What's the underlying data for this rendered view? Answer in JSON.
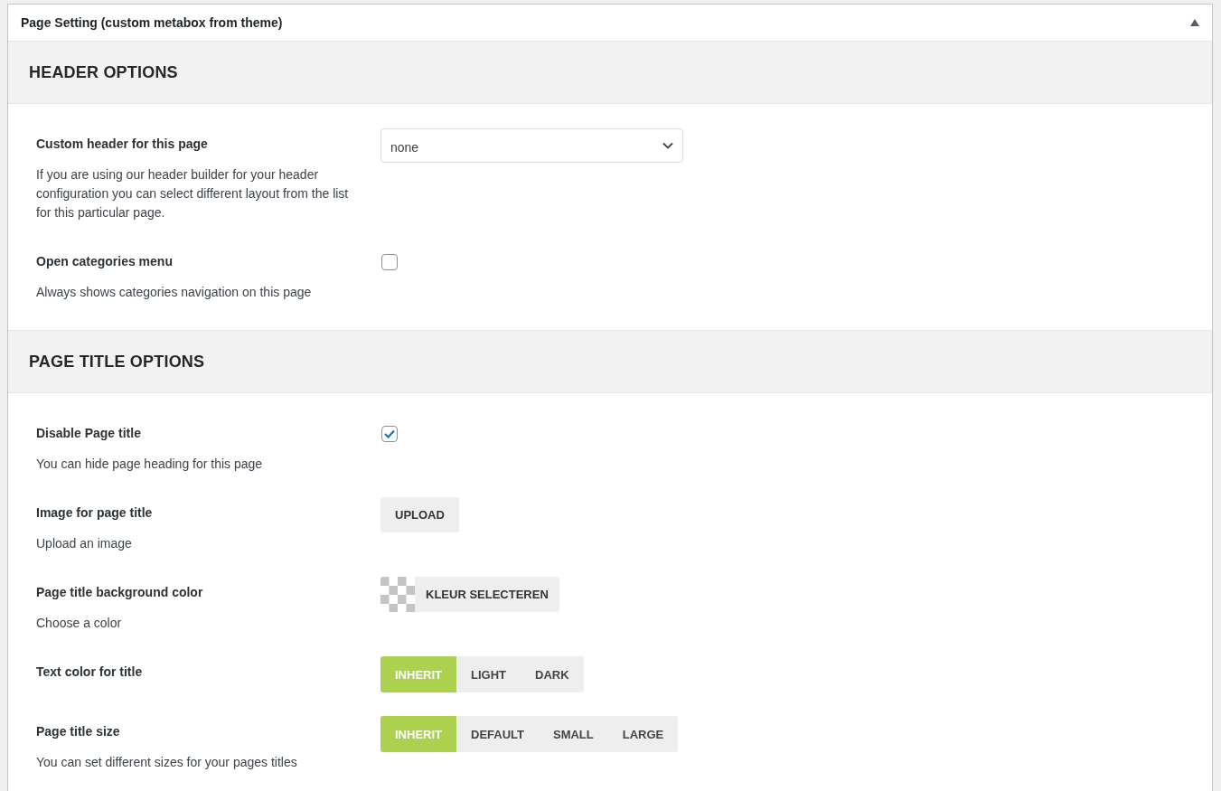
{
  "panel": {
    "title": "Page Setting (custom metabox from theme)",
    "expanded": true
  },
  "sections": [
    {
      "heading": "HEADER OPTIONS",
      "fields": [
        {
          "kind": "select",
          "label": "Custom header for this page",
          "description": "If you are using our header builder for your header configuration you can select different layout from the list for this particular page.",
          "value": "none"
        },
        {
          "kind": "checkbox",
          "label": "Open categories menu",
          "description": "Always shows categories navigation on this page",
          "checked": false
        }
      ]
    },
    {
      "heading": "PAGE TITLE OPTIONS",
      "fields": [
        {
          "kind": "checkbox",
          "label": "Disable Page title",
          "description": "You can hide page heading for this page",
          "checked": true
        },
        {
          "kind": "upload",
          "label": "Image for page title",
          "description": "Upload an image",
          "button": "UPLOAD"
        },
        {
          "kind": "color",
          "label": "Page title background color",
          "description": "Choose a color",
          "button": "KLEUR SELECTEREN"
        },
        {
          "kind": "buttonset",
          "label": "Text color for title",
          "options": [
            {
              "label": "INHERIT",
              "selected": true
            },
            {
              "label": "LIGHT",
              "selected": false
            },
            {
              "label": "DARK",
              "selected": false
            }
          ]
        },
        {
          "kind": "buttonset",
          "label": "Page title size",
          "description": "You can set different sizes for your pages titles",
          "options": [
            {
              "label": "INHERIT",
              "selected": true
            },
            {
              "label": "DEFAULT",
              "selected": false
            },
            {
              "label": "SMALL",
              "selected": false
            },
            {
              "label": "LARGE",
              "selected": false
            }
          ]
        }
      ]
    }
  ]
}
